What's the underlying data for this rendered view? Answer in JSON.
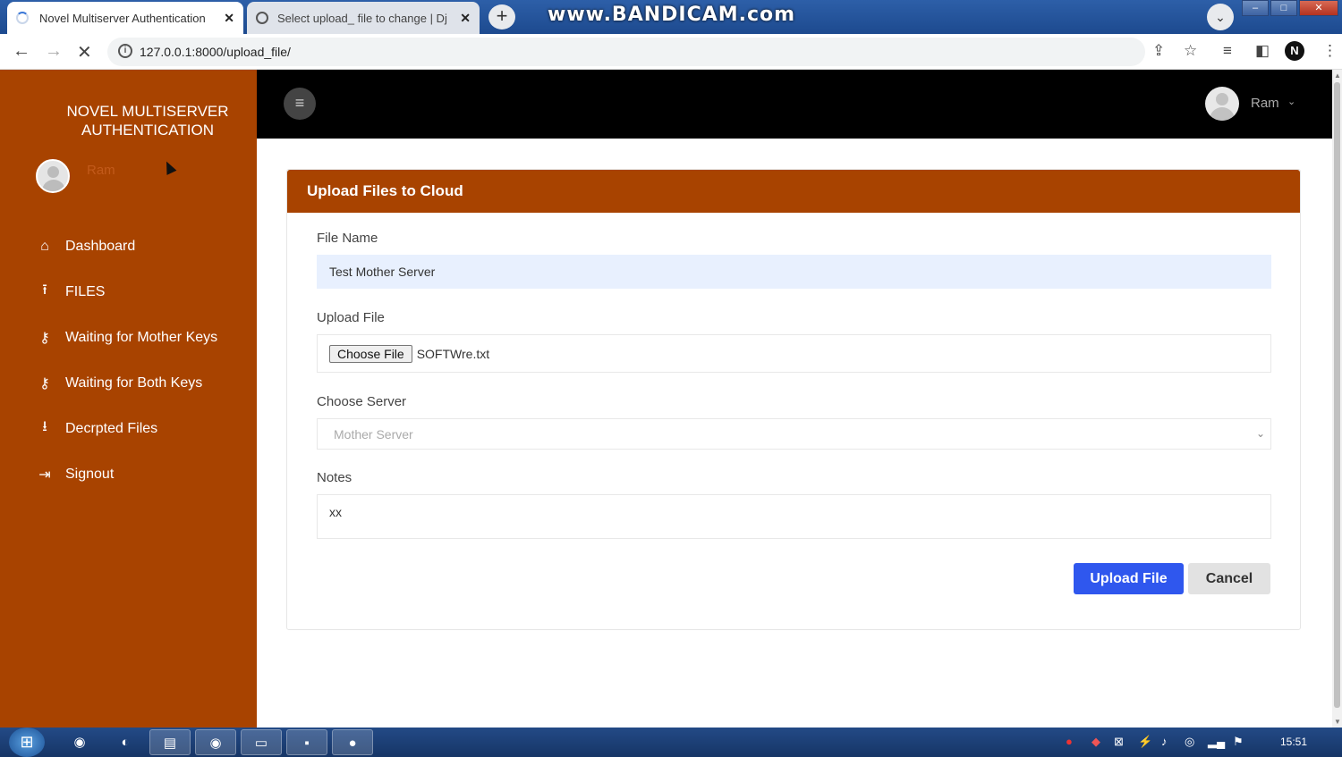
{
  "browser": {
    "tabs": [
      {
        "title": "Novel Multiserver Authentication",
        "close": "✕"
      },
      {
        "title": "Select upload_ file to change | Dj",
        "close": "✕"
      }
    ],
    "new_tab": "+",
    "watermark": "www.BANDICAM.com",
    "url": "127.0.0.1:8000/upload_file/"
  },
  "sidebar": {
    "brand": "NOVEL MULTISERVER AUTHENTICATION",
    "user": "Ram",
    "items": [
      {
        "label": "Dashboard",
        "icon": "home-icon"
      },
      {
        "label": "FILES",
        "icon": "upload-icon"
      },
      {
        "label": "Waiting for Mother Keys",
        "icon": "key-icon"
      },
      {
        "label": "Waiting for Both Keys",
        "icon": "keys-icon"
      },
      {
        "label": "Decrpted Files",
        "icon": "download-icon"
      },
      {
        "label": "Signout",
        "icon": "signout-icon"
      }
    ]
  },
  "header": {
    "user": "Ram"
  },
  "form": {
    "title": "Upload Files to Cloud",
    "file_name_label": "File Name",
    "file_name_value": "Test Mother Server",
    "upload_label": "Upload File",
    "choose_button": "Choose File",
    "chosen_file": "SOFTWre.txt",
    "server_label": "Choose Server",
    "server_value": "Mother Server",
    "notes_label": "Notes",
    "notes_value": "xx",
    "upload_button": "Upload File",
    "cancel_button": "Cancel"
  },
  "taskbar": {
    "clock": "15:51"
  },
  "colors": {
    "sidebar": "#a84300",
    "header": "#000000",
    "primary_button": "#2f57ee"
  }
}
